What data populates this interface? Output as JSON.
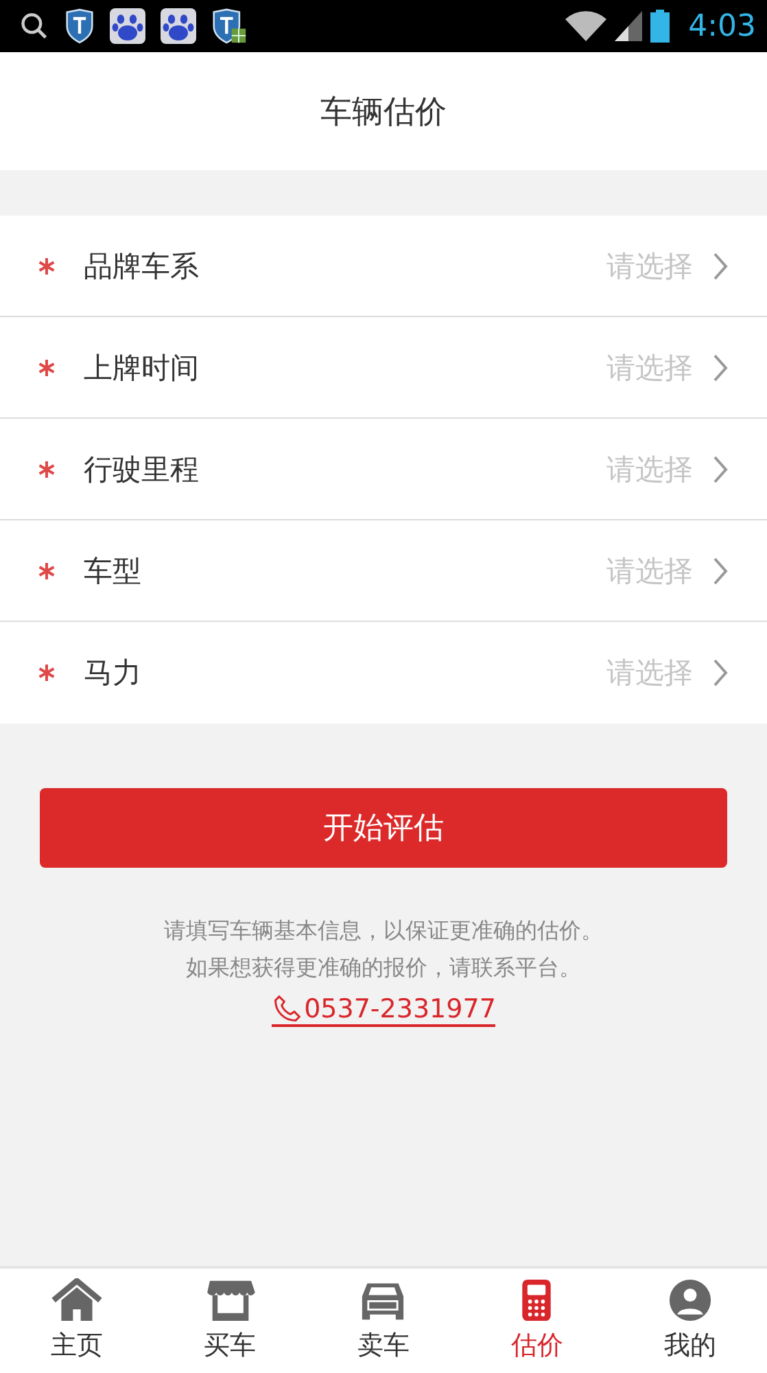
{
  "status_bar": {
    "time": "4:03"
  },
  "header": {
    "title": "车辆估价"
  },
  "form_rows": [
    {
      "label": "品牌车系",
      "required": true,
      "placeholder": "请选择"
    },
    {
      "label": "上牌时间",
      "required": true,
      "placeholder": "请选择"
    },
    {
      "label": "行驶里程",
      "required": true,
      "placeholder": "请选择"
    },
    {
      "label": "车型",
      "required": true,
      "placeholder": "请选择"
    },
    {
      "label": "马力",
      "required": true,
      "placeholder": "请选择"
    }
  ],
  "submit_button": "开始评估",
  "hint_lines": [
    "请填写车辆基本信息，以保证更准确的估价。",
    "如果想获得更准确的报价，请联系平台。"
  ],
  "phone": "0537-2331977",
  "bottom_nav": [
    {
      "kind": "home",
      "label": "主页",
      "selected": false
    },
    {
      "kind": "shop",
      "label": "买车",
      "selected": false
    },
    {
      "kind": "sale",
      "label": "卖车",
      "selected": false
    },
    {
      "kind": "estimate",
      "label": "估价",
      "selected": true
    },
    {
      "kind": "profile",
      "label": "我的",
      "selected": false
    }
  ]
}
